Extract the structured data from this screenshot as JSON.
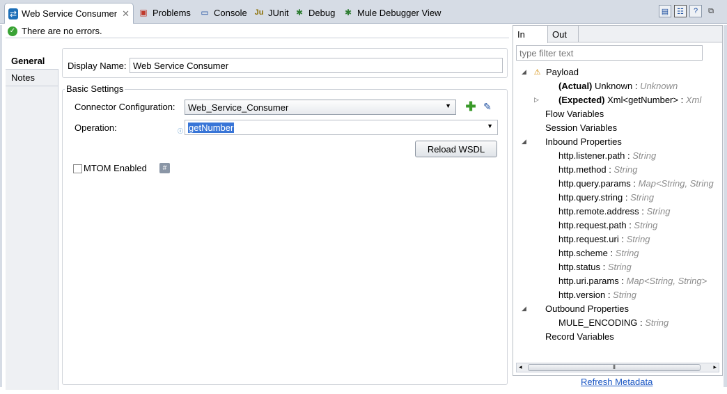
{
  "tabs": {
    "active_label": "Web Service Consumer",
    "problems": "Problems",
    "console": "Console",
    "junit": "JUnit",
    "debug": "Debug",
    "mule_debugger": "Mule Debugger View"
  },
  "status": {
    "message": "There are no errors."
  },
  "nav": {
    "general": "General",
    "notes": "Notes"
  },
  "form": {
    "display_name_label": "Display Name:",
    "display_name_value": "Web Service Consumer",
    "basic_settings_title": "Basic Settings",
    "connector_config_label": "Connector Configuration:",
    "connector_config_value": "Web_Service_Consumer",
    "operation_label": "Operation:",
    "operation_value": "getNumber",
    "reload_wsdl_label": "Reload WSDL",
    "mtom_label": "MTOM Enabled",
    "mtom_checked": false
  },
  "metadata": {
    "tab_in": "In",
    "tab_out": "Out",
    "filter_placeholder": "type filter text",
    "payload": "Payload",
    "actual_label": "(Actual)",
    "actual_value": "Unknown :",
    "actual_type": "Unknown",
    "expected_label": "(Expected)",
    "expected_value": "Xml<getNumber> :",
    "expected_type": "Xml",
    "flow_variables": "Flow Variables",
    "session_variables": "Session Variables",
    "inbound_properties": "Inbound Properties",
    "inbound": [
      {
        "name": "http.listener.path",
        "type": "String"
      },
      {
        "name": "http.method",
        "type": "String"
      },
      {
        "name": "http.query.params",
        "type": "Map<String, String"
      },
      {
        "name": "http.query.string",
        "type": "String"
      },
      {
        "name": "http.remote.address",
        "type": "String"
      },
      {
        "name": "http.request.path",
        "type": "String"
      },
      {
        "name": "http.request.uri",
        "type": "String"
      },
      {
        "name": "http.scheme",
        "type": "String"
      },
      {
        "name": "http.status",
        "type": "String"
      },
      {
        "name": "http.uri.params",
        "type": "Map<String, String>"
      },
      {
        "name": "http.version",
        "type": "String"
      }
    ],
    "outbound_properties": "Outbound Properties",
    "outbound": [
      {
        "name": "MULE_ENCODING",
        "type": "String"
      }
    ],
    "record_variables": "Record Variables",
    "refresh_label": "Refresh Metadata"
  },
  "colors": {
    "accent": "#3875d7",
    "link": "#1a56c4",
    "ok": "#3aa335",
    "warning": "#d38a00"
  }
}
